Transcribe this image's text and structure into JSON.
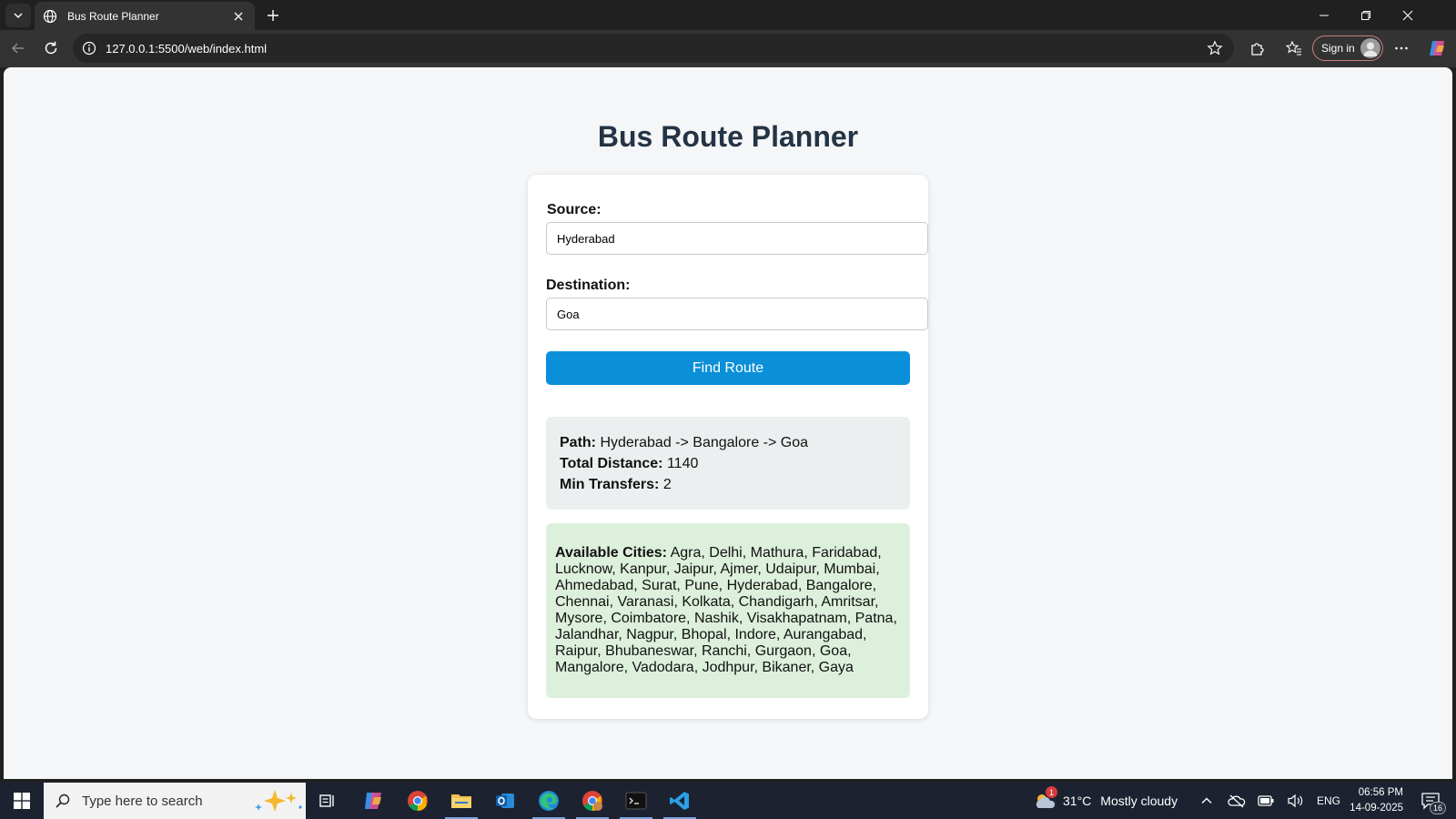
{
  "browser": {
    "tab_title": "Bus Route Planner",
    "url": "127.0.0.1:5500/web/index.html",
    "signin_label": "Sign in"
  },
  "page": {
    "title": "Bus Route Planner",
    "source_label": "Source:",
    "source_value": "Hyderabad",
    "destination_label": "Destination:",
    "destination_value": "Goa",
    "find_button": "Find Route",
    "result": {
      "path_label": "Path:",
      "path_value": "Hyderabad -> Bangalore -> Goa",
      "distance_label": "Total Distance:",
      "distance_value": "1140",
      "transfers_label": "Min Transfers:",
      "transfers_value": "2"
    },
    "cities_label": "Available Cities:",
    "cities_value": "Agra, Delhi, Mathura, Faridabad, Lucknow, Kanpur, Jaipur, Ajmer, Udaipur, Mumbai, Ahmedabad, Surat, Pune, Hyderabad, Bangalore, Chennai, Varanasi, Kolkata, Chandigarh, Amritsar, Mysore, Coimbatore, Nashik, Visakhapatnam, Patna, Jalandhar, Nagpur, Bhopal, Indore, Aurangabad, Raipur, Bhubaneswar, Ranchi, Gurgaon, Goa, Mangalore, Vadodara, Jodhpur, Bikaner, Gaya"
  },
  "taskbar": {
    "search_placeholder": "Type here to search",
    "weather_temp": "31°C",
    "weather_desc": "Mostly cloudy",
    "weather_badge": "1",
    "language": "ENG",
    "time": "06:56 PM",
    "date": "14-09-2025",
    "notification_count": "16"
  },
  "colors": {
    "accent_button": "#0a8fd8",
    "title_text": "#243444",
    "result_bg": "#ebeff0",
    "cities_bg": "#dcf0dc"
  }
}
